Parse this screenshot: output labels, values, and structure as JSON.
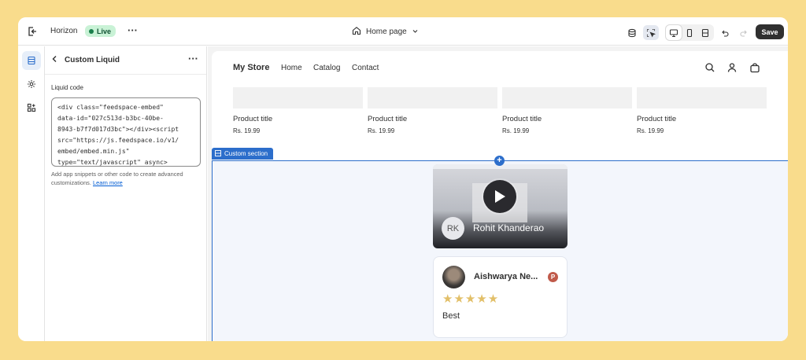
{
  "topbar": {
    "theme_name": "Horizon",
    "status": "Live",
    "page": "Home page",
    "save_label": "Save"
  },
  "panel": {
    "title": "Custom Liquid",
    "field_label": "Liquid code",
    "code": "<div class=\"feedspace-embed\"\ndata-id=\"027c513d-b3bc-40be-\n8943-b7f7d017d3bc\"></div><script\nsrc=\"https://js.feedspace.io/v1/\nembed/embed.min.js\"\ntype=\"text/javascript\" async>",
    "help_text": "Add app snippets or other code to create advanced customizations.",
    "learn_more": "Learn more"
  },
  "store": {
    "brand": "My Store",
    "nav": [
      "Home",
      "Catalog",
      "Contact"
    ],
    "products": [
      {
        "title": "Product title",
        "price": "Rs. 19.99"
      },
      {
        "title": "Product title",
        "price": "Rs. 19.99"
      },
      {
        "title": "Product title",
        "price": "Rs. 19.99"
      },
      {
        "title": "Product title",
        "price": "Rs. 19.99"
      }
    ],
    "section_label": "Custom section",
    "video": {
      "initials": "RK",
      "name": "Rohit Khanderao"
    },
    "review": {
      "name": "Aishwarya Ne...",
      "badge": "P",
      "stars": "★★★★★",
      "rating": 5,
      "text": "Best"
    }
  },
  "colors": {
    "background": "#f9dc8c",
    "accent": "#2c6ecb",
    "live_badge": "#c9f2d6",
    "save_button": "#303030",
    "stars": "#e2bf68"
  }
}
